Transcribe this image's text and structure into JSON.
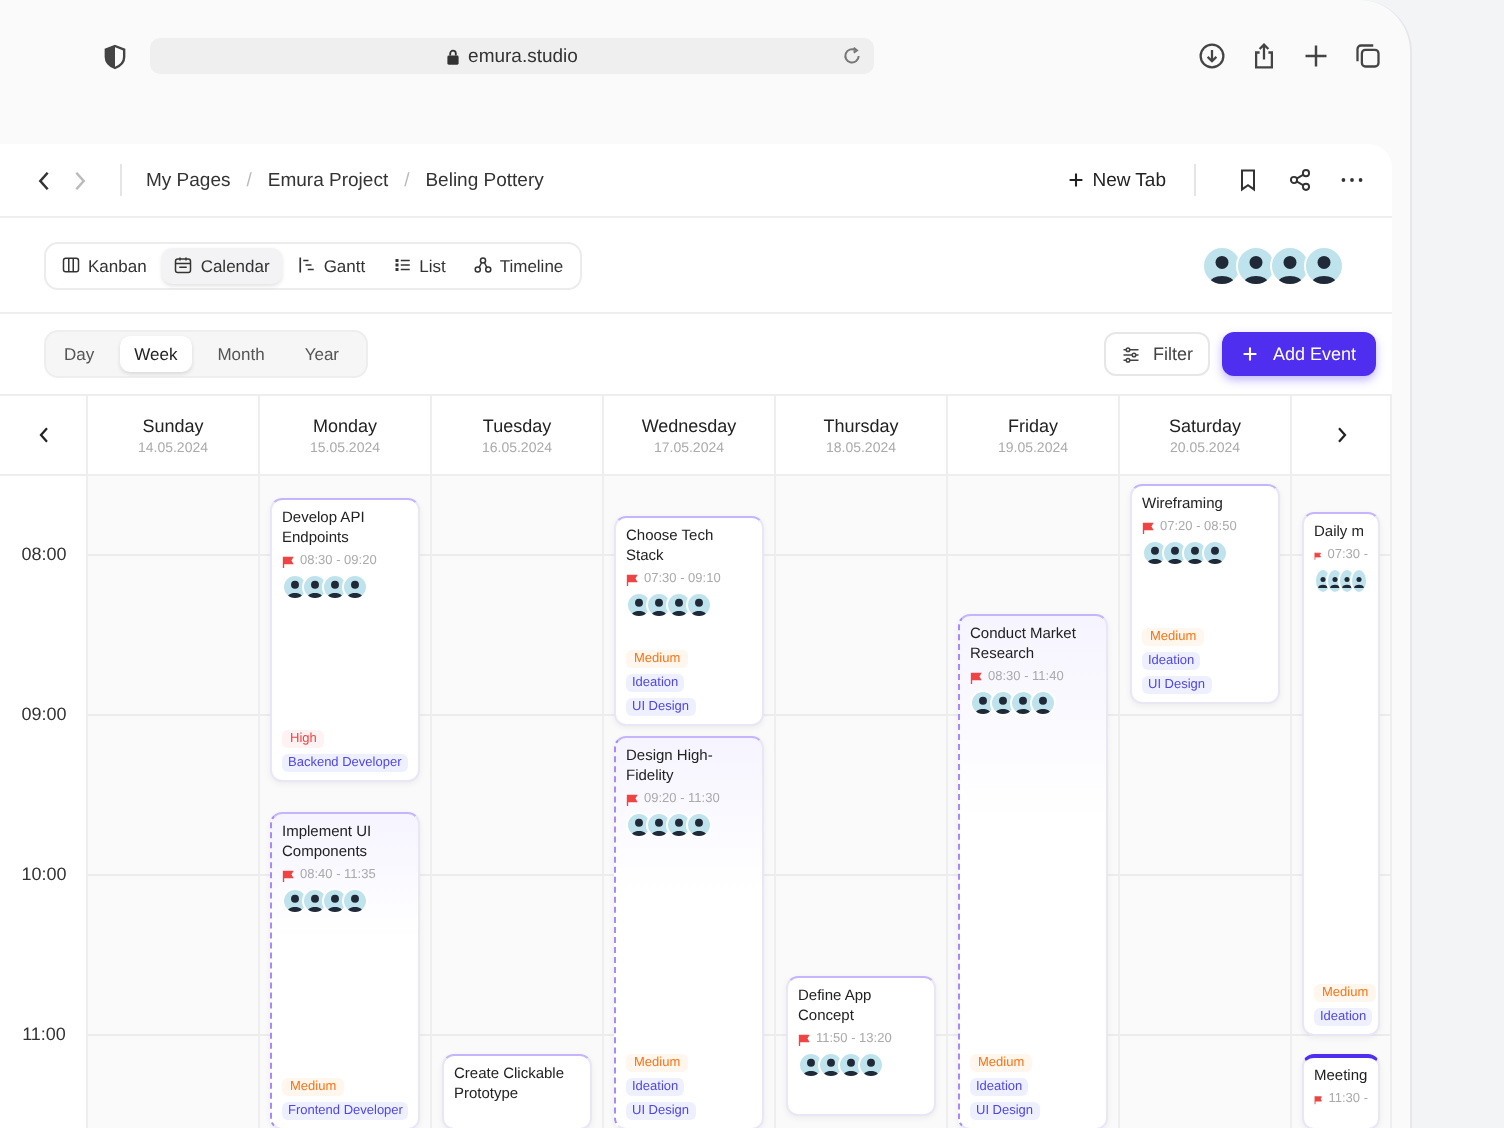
{
  "browser": {
    "url": "emura.studio"
  },
  "breadcrumb": [
    {
      "label": "My Pages"
    },
    {
      "separator": "/",
      "label": "Emura Project"
    },
    {
      "separator": "/",
      "label": "Beling Pottery"
    }
  ],
  "new_tab": "New Tab",
  "views": [
    {
      "label": "Kanban",
      "kind": "kanban",
      "selected": false
    },
    {
      "label": "Calendar",
      "kind": "calendar",
      "selected": true
    },
    {
      "label": "Gantt",
      "kind": "gantt",
      "selected": false
    },
    {
      "label": "List",
      "kind": "list",
      "selected": false
    },
    {
      "label": "Timeline",
      "kind": "timeline",
      "selected": false
    }
  ],
  "ranges": [
    {
      "label": "Day",
      "selected": false
    },
    {
      "label": "Week",
      "selected": true
    },
    {
      "label": "Month",
      "selected": false
    },
    {
      "label": "Year",
      "selected": false
    }
  ],
  "filter": "Filter",
  "add_event": "Add Event",
  "times": [
    "08:00",
    "09:00",
    "10:00",
    "11:00"
  ],
  "days": [
    {
      "name": "Sunday",
      "date": "14.05.2024"
    },
    {
      "name": "Monday",
      "date": "15.05.2024",
      "events": [
        {
          "title": "Develop API Endpoints",
          "time": "08:30 - 09:20",
          "kind": "plain",
          "priority": {
            "label": "High",
            "kind": "high"
          },
          "tags": [
            "Backend Developer"
          ]
        },
        {
          "title": "Implement UI Components",
          "time": "08:40 - 11:35",
          "kind": "dashed",
          "priority": {
            "label": "Medium",
            "kind": "medium"
          },
          "tags": [
            "Frontend Developer"
          ]
        }
      ]
    },
    {
      "name": "Tuesday",
      "date": "16.05.2024",
      "events": [
        {
          "title": "Create Clickable Prototype",
          "kind": "plain"
        }
      ]
    },
    {
      "name": "Wednesday",
      "date": "17.05.2024",
      "events": [
        {
          "title": "Choose Tech Stack",
          "time": "07:30 - 09:10",
          "kind": "plain",
          "priority": {
            "label": "Medium",
            "kind": "medium"
          },
          "tags": [
            "Ideation",
            "UI Design"
          ]
        },
        {
          "title": "Design High-Fidelity",
          "time": "09:20 - 11:30",
          "kind": "dashed",
          "priority": {
            "label": "Medium",
            "kind": "medium"
          },
          "tags": [
            "Ideation",
            "UI Design"
          ]
        }
      ]
    },
    {
      "name": "Thursday",
      "date": "18.05.2024",
      "events": [
        {
          "title": "Define App Concept",
          "time": "11:50 - 13:20",
          "kind": "plain"
        }
      ]
    },
    {
      "name": "Friday",
      "date": "19.05.2024",
      "events": [
        {
          "title": "Conduct Market Research",
          "time": "08:30 - 11:40",
          "kind": "dashed",
          "priority": {
            "label": "Medium",
            "kind": "medium"
          },
          "tags": [
            "Ideation",
            "UI Design"
          ]
        }
      ]
    },
    {
      "name": "Saturday",
      "date": "20.05.2024",
      "events": [
        {
          "title": "Wireframing",
          "time": "07:20 - 08:50",
          "kind": "plain",
          "priority": {
            "label": "Medium",
            "kind": "medium"
          },
          "tags": [
            "Ideation",
            "UI Design"
          ]
        }
      ]
    }
  ],
  "next_column": {
    "events": [
      {
        "title": "Daily m",
        "time": "07:30 -",
        "kind": "plain",
        "priority": {
          "label": "Medium",
          "kind": "medium"
        },
        "tags": [
          "Ideation"
        ]
      },
      {
        "title": "Meeting",
        "time": "11:30 -",
        "kind": "accent"
      }
    ]
  }
}
